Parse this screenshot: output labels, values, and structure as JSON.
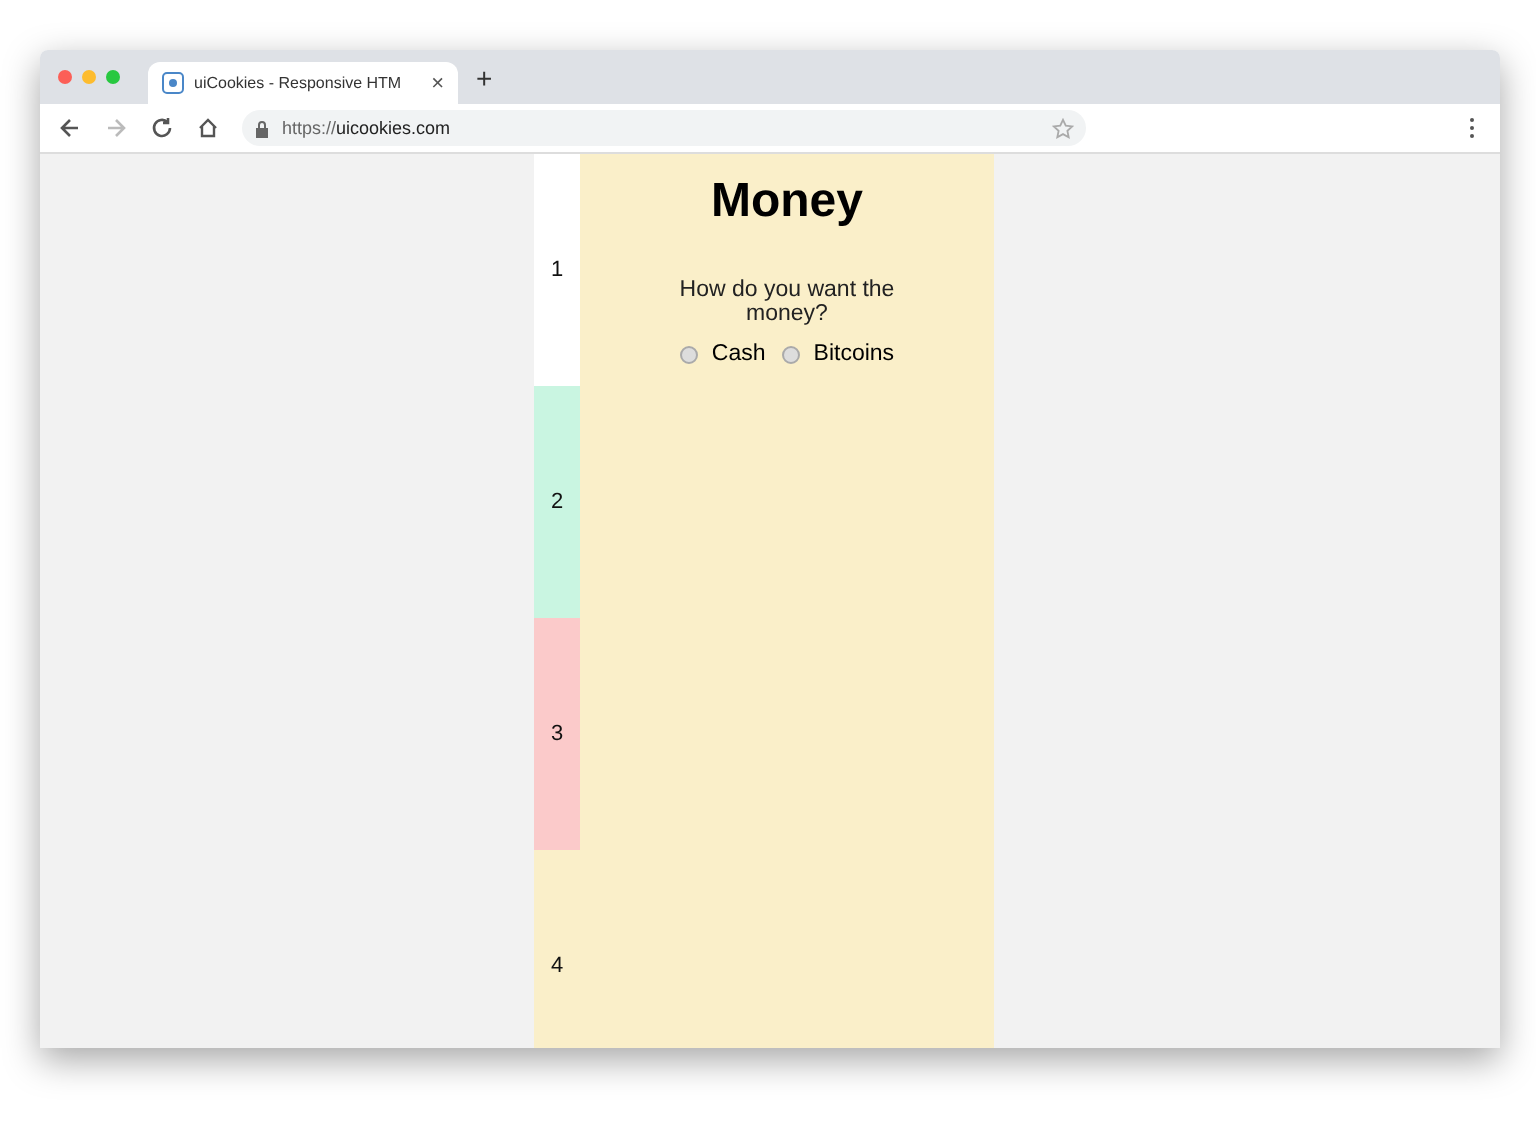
{
  "browser": {
    "tab_title": "uiCookies - Responsive HTM",
    "close": "×",
    "new_tab": "+",
    "url_scheme": "https://",
    "url_host": "uicookies.com"
  },
  "steps": [
    {
      "label": "1",
      "color": "#ffffff"
    },
    {
      "label": "2",
      "color": "#c9f5e1"
    },
    {
      "label": "3",
      "color": "#fbcaca"
    },
    {
      "label": "4",
      "color": "#faefc9"
    }
  ],
  "panel": {
    "title": "Money",
    "question": "How do you want the money?",
    "options": [
      {
        "label": "Cash",
        "selected": false
      },
      {
        "label": "Bitcoins",
        "selected": false
      }
    ]
  }
}
